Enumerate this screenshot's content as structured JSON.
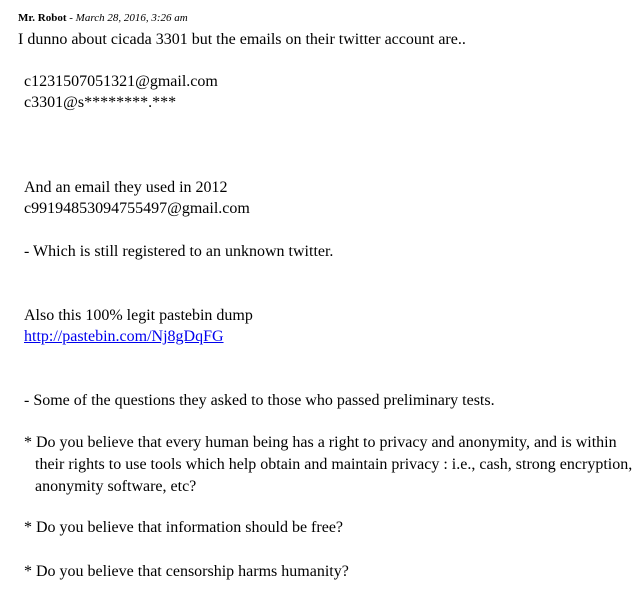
{
  "comment": {
    "author": "Mr. Robot",
    "separator": " - ",
    "date": "March 28, 2016, 3:26 am",
    "intro": "I dunno about cicada 3301 but the emails on their twitter account are..",
    "emails": [
      "c1231507051321@gmail.com",
      "c3301@s********.***"
    ],
    "email_2012_intro": "And an email they used in 2012",
    "email_2012": "c99194853094755497@gmail.com",
    "registered_note": "- Which is still registered to an unknown twitter.",
    "pastebin_intro": "Also this 100% legit pastebin dump",
    "pastebin_link": "http://pastebin.com/Nj8gDqFG",
    "questions_intro": "- Some of the questions they asked to those who passed preliminary tests.",
    "questions": [
      "* Do you believe that every human being has a right to privacy and anonymity, and is within their rights to use tools which help obtain and maintain privacy : i.e., cash, strong encryption, anonymity software, etc?",
      "* Do you believe that information should be free?",
      "* Do you believe that censorship harms humanity?"
    ]
  }
}
